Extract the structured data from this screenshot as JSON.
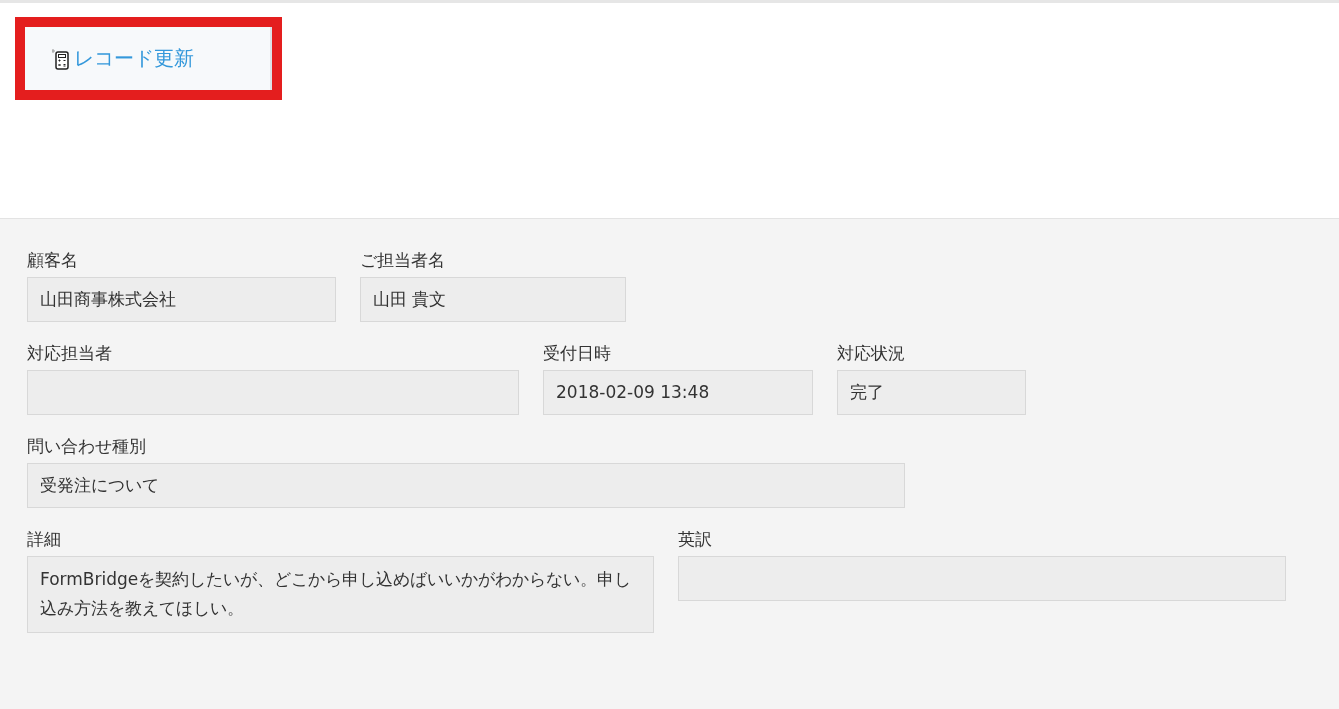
{
  "update_button": {
    "label": "レコード更新",
    "highlighted": true
  },
  "rows": [
    {
      "fields": [
        {
          "label": "顧客名",
          "value": "山田商事株式会社"
        },
        {
          "label": "ご担当者名",
          "value": "山田 貴文"
        }
      ]
    },
    {
      "fields": [
        {
          "label": "対応担当者"
        },
        {
          "label": "受付日時",
          "value": "2018-02-09 13:48"
        },
        {
          "label": "対応状況",
          "value": "完了"
        }
      ]
    },
    {
      "fields": [
        {
          "label": "問い合わせ種別",
          "value": "受発注について"
        }
      ]
    },
    {
      "fields": [
        {
          "label": "詳細",
          "value": "FormBridgeを契約したいが、どこから申し込めばいいかがわからない。申し込み方法を教えてほしい。",
          "kind": "multiline"
        },
        {
          "label": "英訳"
        }
      ]
    }
  ]
}
